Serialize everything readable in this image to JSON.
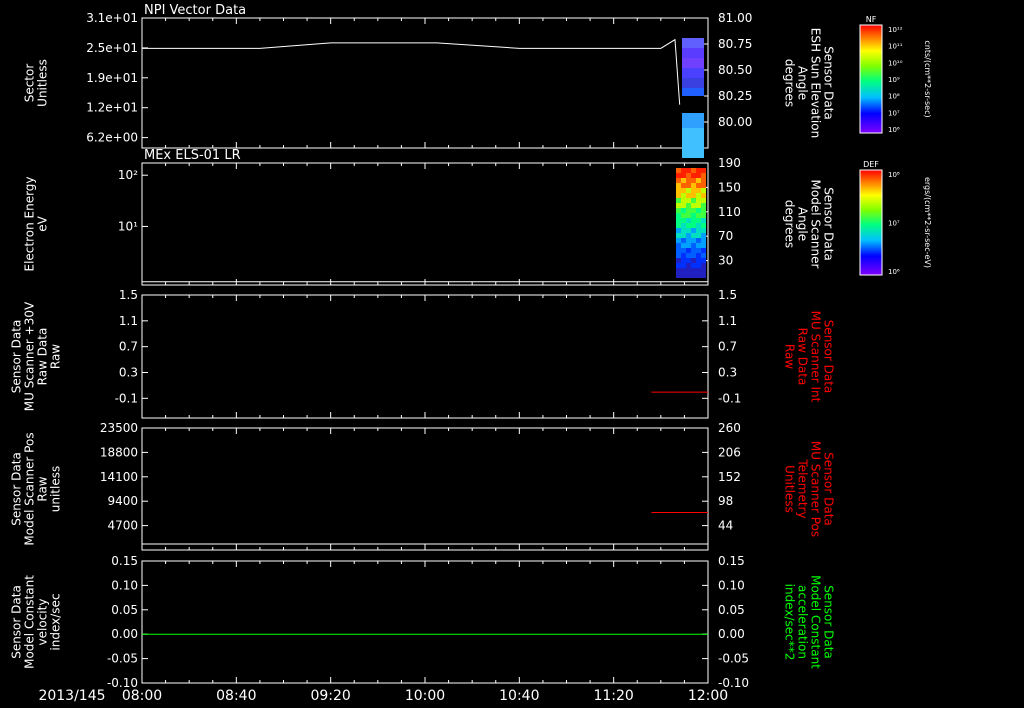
{
  "date_label": "2013/145",
  "x_ticks": [
    "08:00",
    "08:40",
    "09:20",
    "10:00",
    "10:40",
    "11:20",
    "12:00"
  ],
  "colors": {
    "white": "#ffffff",
    "red": "#ff0000",
    "green": "#00ff00",
    "black": "#000000"
  },
  "chart_data": [
    {
      "type": "heatmap",
      "title": "NPI Vector Data",
      "ylabel_left": [
        "Sector",
        "Unitless"
      ],
      "ylabel_right": [
        "Sensor Data",
        "ESH Sun Elevation",
        "Angle",
        "degrees"
      ],
      "left_ticks": [
        "3.1e+01",
        "2.5e+01",
        "1.9e+01",
        "1.2e+01",
        "6.2e+00"
      ],
      "right_ticks": [
        "81.00",
        "80.75",
        "80.50",
        "80.25",
        "80.00"
      ],
      "right_ylim": [
        79.8,
        81.0
      ],
      "line_series": {
        "name": "ESH Sun Elevation Angle",
        "x": [
          "08:00",
          "08:50",
          "09:20",
          "10:05",
          "10:40",
          "11:40",
          "11:46",
          "11:48"
        ],
        "y": [
          80.72,
          80.72,
          80.77,
          80.77,
          80.72,
          80.72,
          80.8,
          80.2
        ]
      },
      "colorbar": {
        "label": "NF",
        "units": "cnts/(cm**2-sr-sec)",
        "ticks": [
          "10¹²",
          "10¹¹",
          "10¹⁰",
          "10⁹",
          "10⁸",
          "10⁷",
          "10⁶"
        ]
      }
    },
    {
      "type": "heatmap",
      "title": "MEx ELS-01 LR",
      "ylabel_left": [
        "Electron Energy",
        "eV"
      ],
      "ylabel_right": [
        "Sensor Data",
        "Model Scanner",
        "Angle",
        "degrees"
      ],
      "left_ticks": [
        "10²",
        "10¹"
      ],
      "right_ticks": [
        "190",
        "150",
        "110",
        "70",
        "30"
      ],
      "right_ylim": [
        0,
        190
      ],
      "line_series": {
        "name": "Model Scanner Angle",
        "x": [
          "08:00",
          "12:00"
        ],
        "y": [
          5,
          5
        ]
      },
      "colorbar": {
        "label": "DEF",
        "units": "ergs/(cm**2-sr-sec-eV)",
        "ticks": [
          "10⁸",
          "10⁷",
          "10⁶"
        ]
      }
    },
    {
      "type": "line",
      "ylabel_left": [
        "Sensor Data",
        "MU Scanner +30V",
        "Raw Data",
        "Raw"
      ],
      "ylabel_right": [
        "Sensor Data",
        "MU Scanner Int",
        "Raw Data",
        "Raw"
      ],
      "left_ticks": [
        "1.5",
        "1.1",
        "0.7",
        "0.3",
        "-0.1"
      ],
      "right_ticks": [
        "1.5",
        "1.1",
        "0.7",
        "0.3",
        "-0.1"
      ],
      "ylim": [
        -0.4,
        1.5
      ],
      "series": [
        {
          "name": "MU Scanner Int Raw Data",
          "x": [
            "11:36",
            "12:00"
          ],
          "y": [
            0.0,
            0.0
          ]
        }
      ]
    },
    {
      "type": "line",
      "ylabel_left": [
        "Sensor Data",
        "Model Scanner Pos",
        "Raw",
        "unitless"
      ],
      "ylabel_right": [
        "Sensor Data",
        "MU Scanner Pos",
        "Telemetry",
        "Unitless"
      ],
      "left_ticks": [
        "23500",
        "18800",
        "14100",
        "9400",
        "4700"
      ],
      "right_ticks": [
        "260",
        "206",
        "152",
        "98",
        "44"
      ],
      "left_ylim": [
        0,
        23500
      ],
      "right_ylim": [
        0,
        260
      ],
      "series": [
        {
          "name": "Model Scanner Pos",
          "axis": "left",
          "x": [
            "08:00",
            "12:00"
          ],
          "y": [
            0,
            0
          ]
        },
        {
          "name": "MU Scanner Pos Telemetry",
          "axis": "right",
          "x": [
            "11:36",
            "12:00"
          ],
          "y": [
            80,
            80
          ]
        }
      ]
    },
    {
      "type": "line",
      "ylabel_left": [
        "Sensor Data",
        "Model Constant",
        "velocity",
        "index/sec"
      ],
      "ylabel_right": [
        "Sensor Data",
        "Model Constant",
        "acceleration",
        "index/sec**2"
      ],
      "left_ticks": [
        "0.15",
        "0.10",
        "0.05",
        "0.00",
        "-0.05",
        "-0.10"
      ],
      "right_ticks": [
        "0.15",
        "0.10",
        "0.05",
        "0.00",
        "-0.05",
        "-0.10"
      ],
      "ylim": [
        -0.1,
        0.15
      ],
      "series": [
        {
          "name": "Model Constant acceleration",
          "x": [
            "08:00",
            "12:00"
          ],
          "y": [
            0.0,
            0.0
          ]
        }
      ]
    }
  ]
}
